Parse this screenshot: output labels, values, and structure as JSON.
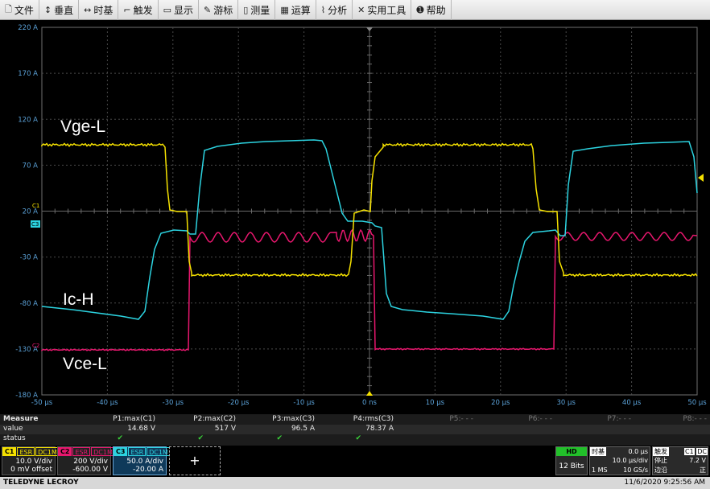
{
  "menu": [
    {
      "icon": "file-icon",
      "glyph": "🗋",
      "label": "文件"
    },
    {
      "icon": "vertical-icon",
      "glyph": "↕",
      "label": "垂直"
    },
    {
      "icon": "timebase-icon",
      "glyph": "↔",
      "label": "时基"
    },
    {
      "icon": "trigger-icon",
      "glyph": "⌐",
      "label": "触发"
    },
    {
      "icon": "display-icon",
      "glyph": "▭",
      "label": "显示"
    },
    {
      "icon": "cursor-icon",
      "glyph": "✎",
      "label": "游标"
    },
    {
      "icon": "measure-icon",
      "glyph": "▯",
      "label": "测量"
    },
    {
      "icon": "math-icon",
      "glyph": "▦",
      "label": "运算"
    },
    {
      "icon": "analysis-icon",
      "glyph": "⌇",
      "label": "分析"
    },
    {
      "icon": "tools-icon",
      "glyph": "✕",
      "label": "实用工具"
    },
    {
      "icon": "help-icon",
      "glyph": "➊",
      "label": "帮助"
    }
  ],
  "grid": {
    "y_ticks": [
      "220 A",
      "170 A",
      "120 A",
      "70 A",
      "20 A",
      "-30 A",
      "-80 A",
      "-130 A",
      "-180 A"
    ],
    "x_ticks": [
      "-50 µs",
      "-40 µs",
      "-30 µs",
      "-20 µs",
      "-10 µs",
      "0 ns",
      "10 µs",
      "20 µs",
      "30 µs",
      "40 µs",
      "50 µs"
    ],
    "grid_color": "#4a4a4a",
    "axis_color": "#5aa0d6"
  },
  "markers": {
    "c1": "C1",
    "c2": "C2",
    "c3": "C3"
  },
  "waveform_labels": {
    "vge": "Vge-L",
    "ic": "Ic-H",
    "vce": "Vce-L"
  },
  "colors": {
    "c1": "#f5e100",
    "c2": "#e8176e",
    "c3": "#2cd3e0"
  },
  "measure": {
    "title": "Measure",
    "row_value": "value",
    "row_status": "status",
    "params": [
      {
        "name": "P1:max(C1)",
        "value": "14.68 V",
        "ok": "✔"
      },
      {
        "name": "P2:max(C2)",
        "value": "517 V",
        "ok": "✔"
      },
      {
        "name": "P3:max(C3)",
        "value": "96.5 A",
        "ok": "✔"
      },
      {
        "name": "P4:rms(C3)",
        "value": "78.37 A",
        "ok": "✔"
      },
      {
        "name": "P5:- - -",
        "value": "",
        "ok": ""
      },
      {
        "name": "P6:- - -",
        "value": "",
        "ok": ""
      },
      {
        "name": "P7:- - -",
        "value": "",
        "ok": ""
      },
      {
        "name": "P8:- - -",
        "value": "",
        "ok": ""
      }
    ]
  },
  "channels": [
    {
      "tag": "C1",
      "f1": "ESR",
      "f2": "DC1M",
      "scale": "10.0 V/div",
      "offset": "0 mV offset"
    },
    {
      "tag": "C2",
      "f1": "ESR",
      "f2": "DC1M",
      "scale": "200 V/div",
      "offset": "-600.00 V"
    },
    {
      "tag": "C3",
      "f1": "ESR",
      "f2": "DC1M",
      "scale": "50.0 A/div",
      "offset": "-20.00 A"
    }
  ],
  "add_channel": "+",
  "acq": {
    "hd": "HD",
    "bits": "12 Bits"
  },
  "timebase": {
    "title": "时基",
    "delay": "0.0 µs",
    "per_div": "10.0 µs/div",
    "memory": "1 MS",
    "rate": "10 GS/s"
  },
  "trigger": {
    "title": "触发",
    "c1": "C1",
    "dc": "DC",
    "mode": "停止",
    "type": "边沿",
    "level": "7.2 V",
    "slope": "正"
  },
  "status": {
    "brand": "TELEDYNE LECROY",
    "datetime": "11/6/2020  9:25:56 AM"
  }
}
